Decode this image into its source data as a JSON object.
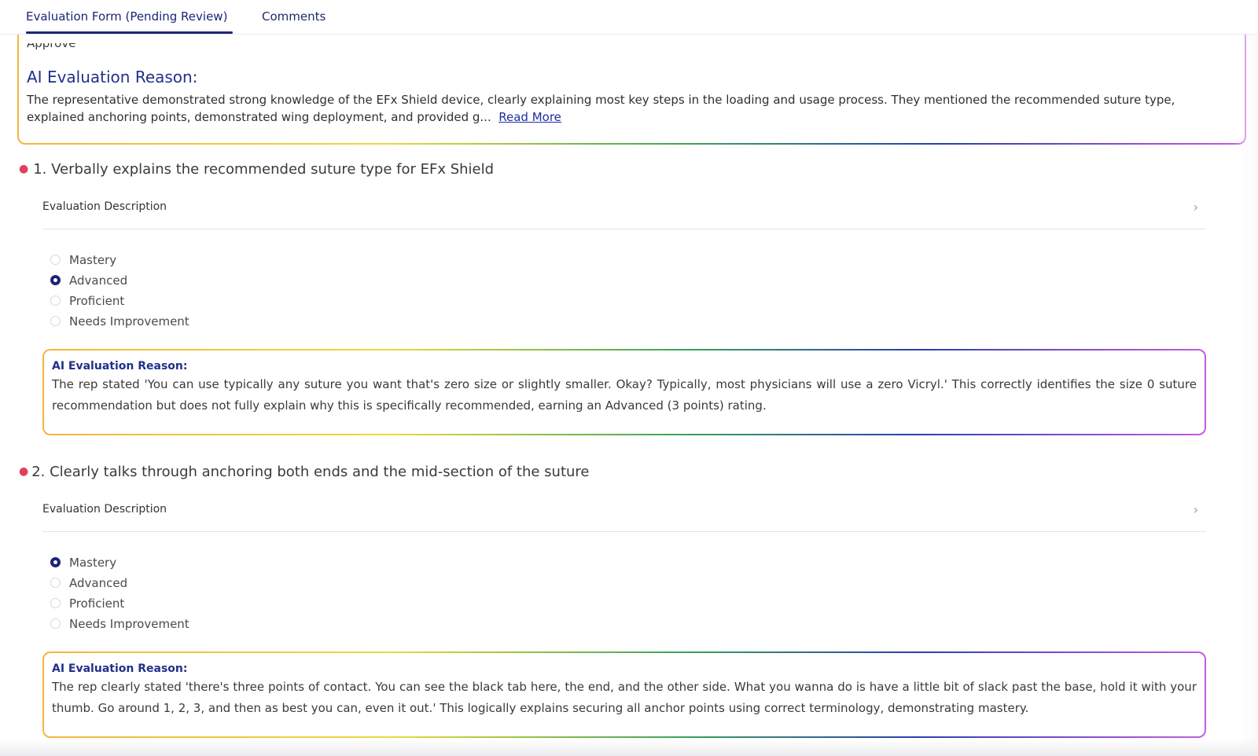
{
  "tabs": {
    "evaluation_form": "Evaluation Form (Pending Review)",
    "comments": "Comments"
  },
  "summary": {
    "cut_text": "Approve",
    "title": "AI Evaluation Reason:",
    "text": "The representative demonstrated strong knowledge of the EFx Shield device, clearly explaining most key steps in the loading and usage process. They mentioned the recommended suture type, explained anchoring points, demonstrated wing deployment, and provided g...",
    "read_more": "Read More"
  },
  "questions": [
    {
      "title": "1. Verbally explains the recommended suture type for EFx Shield",
      "description_label": "Evaluation Description",
      "options": [
        "Mastery",
        "Advanced",
        "Proficient",
        "Needs Improvement"
      ],
      "selected": "Advanced",
      "reason_title": "AI Evaluation Reason:",
      "reason_text": "The rep stated 'You can use typically any suture you want that's zero size or slightly smaller. Okay? Typically, most physicians will use a zero Vicryl.' This correctly identifies the size 0 suture recommendation but does not fully explain why this is specifically recommended, earning an Advanced (3 points) rating."
    },
    {
      "title": "2. Clearly talks through anchoring both ends and the mid-section of the suture",
      "description_label": "Evaluation Description",
      "options": [
        "Mastery",
        "Advanced",
        "Proficient",
        "Needs Improvement"
      ],
      "selected": "Mastery",
      "reason_title": "AI Evaluation Reason:",
      "reason_text": "The rep clearly stated 'there's three points of contact. You can see the black tab here, the end, and the other side. What you wanna do is have a little bit of slack past the base, hold it with your thumb. Go around 1, 2, 3, and then as best you can, even it out.' This logically explains securing all anchor points using correct terminology, demonstrating mastery."
    }
  ],
  "icons": {
    "chevron": "chevron-right-icon",
    "required": "required-dot-icon"
  },
  "colors": {
    "accent": "#1c2478",
    "required": "#e0405a"
  }
}
